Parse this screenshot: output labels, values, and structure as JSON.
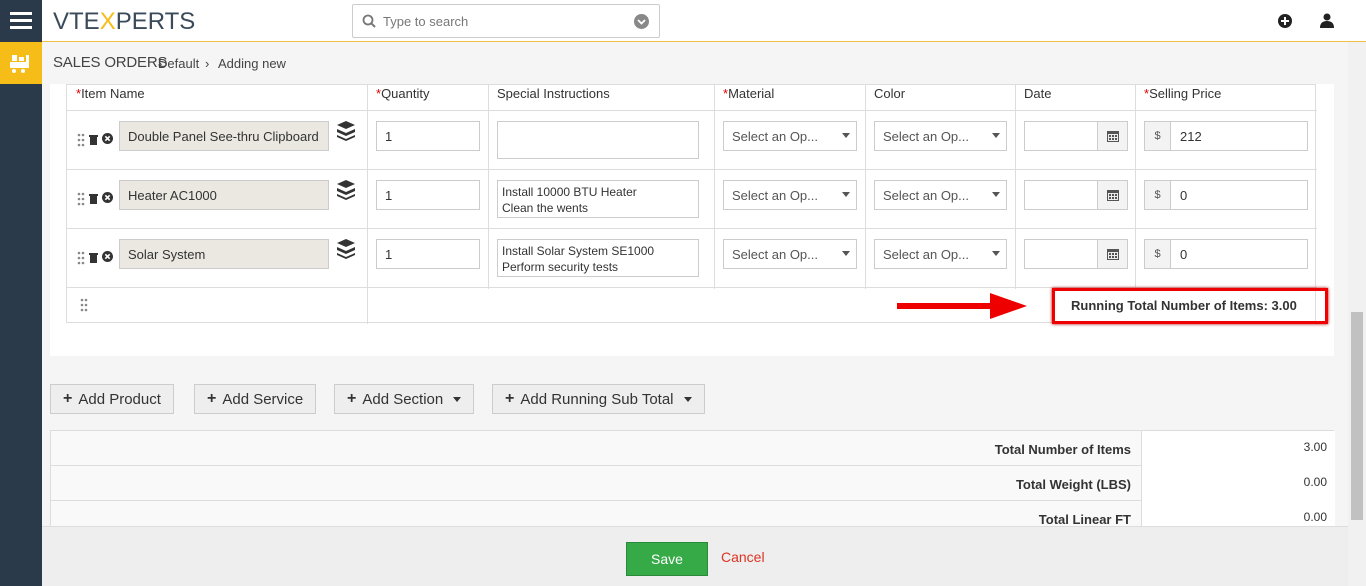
{
  "app": {
    "logo_prefix": "VTE",
    "logo_x": "X",
    "logo_suffix": "PERTS"
  },
  "search": {
    "placeholder": "Type to search"
  },
  "breadcrumb": {
    "module": "SALES ORDERS",
    "items": [
      "Default",
      "Adding new"
    ]
  },
  "table": {
    "headers": {
      "item_name": "Item Name",
      "quantity": "Quantity",
      "special_instructions": "Special Instructions",
      "material": "Material",
      "color": "Color",
      "date": "Date",
      "selling_price": "Selling Price"
    },
    "required_mark": "*",
    "rows": [
      {
        "name": "Double Panel See-thru Clipboard",
        "quantity": "1",
        "instructions": "",
        "material": "Select an Op...",
        "color": "Select an Op...",
        "date": "",
        "currency": "$",
        "price": "212"
      },
      {
        "name": "Heater AC1000",
        "quantity": "1",
        "instructions": "Install 10000 BTU Heater\nClean the wents",
        "material": "Select an Op...",
        "color": "Select an Op...",
        "date": "",
        "currency": "$",
        "price": "0"
      },
      {
        "name": "Solar System",
        "quantity": "1",
        "instructions": "Install Solar System SE1000\nPerform security tests",
        "material": "Select an Op...",
        "color": "Select an Op...",
        "date": "",
        "currency": "$",
        "price": "0"
      }
    ],
    "running_total": "Running Total Number of Items: 3.00"
  },
  "actions": {
    "add_product": "Add Product",
    "add_service": "Add Service",
    "add_section": "Add Section",
    "add_running_sub_total": "Add Running Sub Total"
  },
  "totals": [
    {
      "label": "Total Number of Items",
      "value": "3.00"
    },
    {
      "label": "Total Weight (LBS)",
      "value": "0.00"
    },
    {
      "label": "Total Linear FT",
      "value": "0.00"
    }
  ],
  "footer": {
    "save": "Save",
    "cancel": "Cancel"
  },
  "colors": {
    "accent": "#f6bd18",
    "sidebar": "#2b3a4a",
    "save": "#35aa47",
    "highlight": "#e00000"
  }
}
